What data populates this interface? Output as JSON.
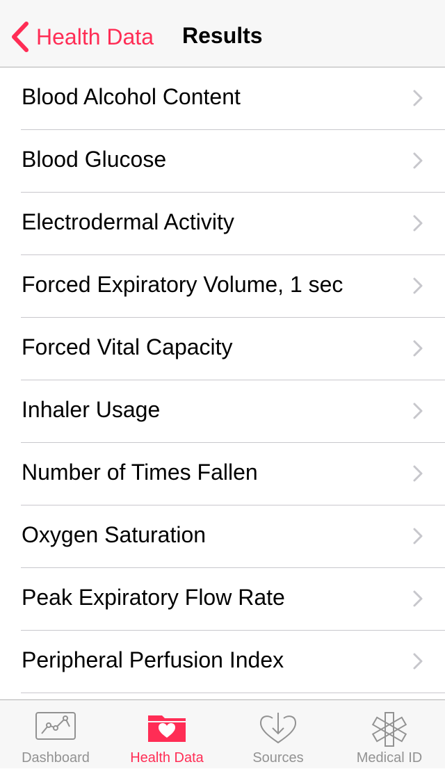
{
  "navbar": {
    "back_label": "Health Data",
    "title": "Results"
  },
  "list": {
    "items": [
      {
        "label": "Blood Alcohol Content"
      },
      {
        "label": "Blood Glucose"
      },
      {
        "label": "Electrodermal Activity"
      },
      {
        "label": "Forced Expiratory Volume, 1 sec"
      },
      {
        "label": "Forced Vital Capacity"
      },
      {
        "label": "Inhaler Usage"
      },
      {
        "label": "Number of Times Fallen"
      },
      {
        "label": "Oxygen Saturation"
      },
      {
        "label": "Peak Expiratory Flow Rate"
      },
      {
        "label": "Peripheral Perfusion Index"
      }
    ]
  },
  "tabbar": {
    "tabs": [
      {
        "label": "Dashboard",
        "icon": "dashboard-chart-icon",
        "active": false
      },
      {
        "label": "Health Data",
        "icon": "folder-heart-icon",
        "active": true
      },
      {
        "label": "Sources",
        "icon": "heart-download-icon",
        "active": false
      },
      {
        "label": "Medical ID",
        "icon": "medical-star-icon",
        "active": false
      }
    ]
  },
  "colors": {
    "accent": "#ff2d55",
    "inactive": "#929292",
    "chevron": "#c7c7cc",
    "separator": "#c8c7cc",
    "bar_background": "#f7f7f7"
  }
}
